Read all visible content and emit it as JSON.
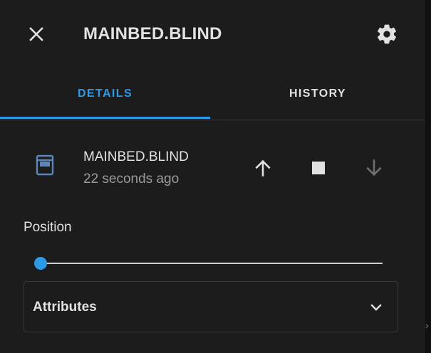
{
  "dialog": {
    "title": "MAINBED.BLIND",
    "close_icon": "close-icon",
    "settings_icon": "gear-icon"
  },
  "tabs": [
    {
      "label": "DETAILS",
      "active": true
    },
    {
      "label": "HISTORY",
      "active": false
    }
  ],
  "entity": {
    "name": "MAINBED.BLIND",
    "last_changed": "22 seconds ago",
    "icon": "window-shutter-icon",
    "controls": {
      "open_icon": "arrow-up-icon",
      "stop_icon": "stop-icon",
      "close_icon": "arrow-down-icon",
      "close_disabled": true
    }
  },
  "position": {
    "label": "Position",
    "value_percent": 0
  },
  "attributes": {
    "label": "Attributes",
    "expanded": false
  },
  "colors": {
    "accent": "#2d9ae8",
    "background": "#1c1c1c",
    "text": "#e1e1e1",
    "secondary_text": "#9b9b9b",
    "disabled_icon": "#6f6f6f"
  }
}
